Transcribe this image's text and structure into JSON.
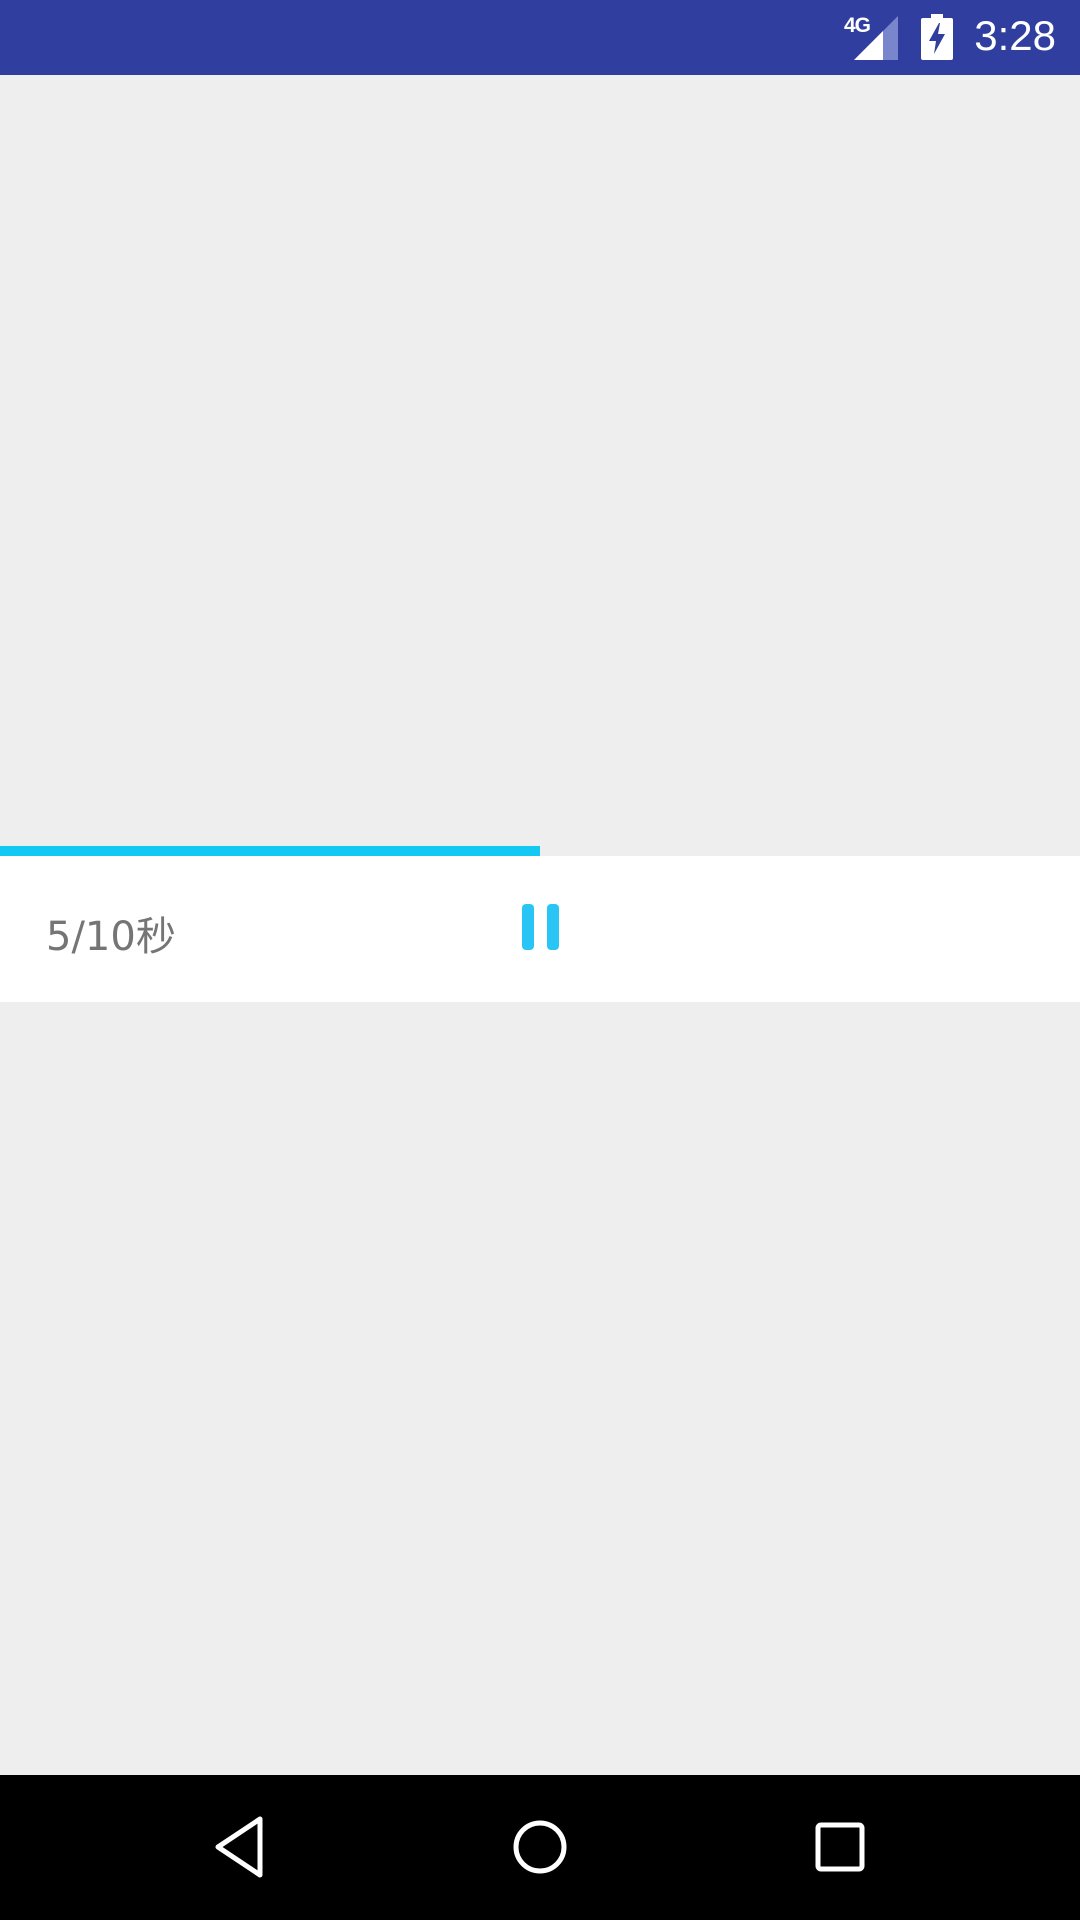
{
  "status_bar": {
    "network_type": "4G",
    "time": "3:28",
    "icons": [
      "signal-icon",
      "battery-charging-icon"
    ],
    "background_color": "#303f9f"
  },
  "player": {
    "time_label": "5/10秒",
    "progress": 0.5,
    "accent_color": "#13c8f2",
    "control_icon": "pause-icon"
  },
  "nav_bar": {
    "buttons": [
      "back-icon",
      "home-icon",
      "recents-icon"
    ]
  }
}
